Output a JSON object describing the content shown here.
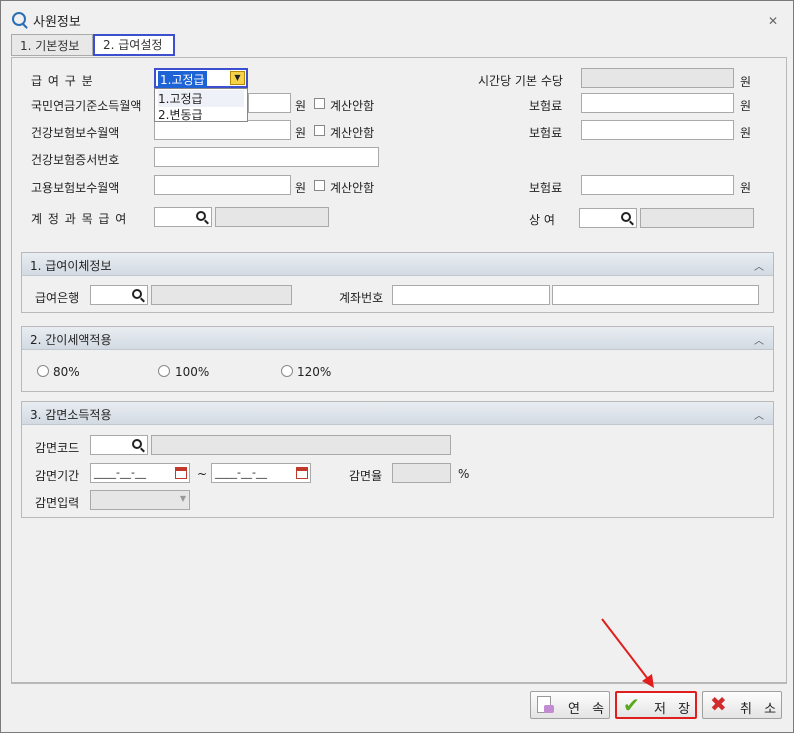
{
  "window": {
    "title": "사원정보",
    "close_glyph": "✕"
  },
  "tabs": [
    {
      "label": "1. 기본정보",
      "active": false
    },
    {
      "label": "2. 급여설정",
      "active": true
    }
  ],
  "form": {
    "pay_type_label": "급 여 구 분",
    "pay_type_value": "1.고정급",
    "pay_type_options": [
      "1.고정급",
      "2.변동급"
    ],
    "hourly_allowance_label": "시간당 기본 수당",
    "won": "원",
    "pension_label": "국민연금기준소득월액",
    "pension_premium_label": "보험료",
    "no_calc_label": "계산안함",
    "health_label": "건강보험보수월액",
    "health_premium_label": "보험료",
    "health_card_label": "건강보험증서번호",
    "employment_label": "고용보험보수월액",
    "employment_premium_label": "보험료",
    "account_subject_label": "계 정 과 목  급 여",
    "bonus_label": "상    여"
  },
  "section1": {
    "title": "1. 급여이체정보",
    "bank_label": "급여은행",
    "account_no_label": "계좌번호"
  },
  "section2": {
    "title": "2. 간이세액적용",
    "options": [
      "80%",
      "100%",
      "120%"
    ]
  },
  "section3": {
    "title": "3. 감면소득적용",
    "code_label": "감면코드",
    "period_label": "감면기간",
    "date_from": "____-__-__",
    "date_to": "____-__-__",
    "tilde": "~",
    "rate_label": "감면율",
    "percent": "%",
    "input_label": "감면입력"
  },
  "buttons": {
    "continue": "연 속",
    "save": "저 장",
    "cancel": "취 소"
  },
  "colors": {
    "highlight_border": "#3b4fcf",
    "annotation_red": "#e01e1e",
    "section_header": "#d9dfe6",
    "selected_option": "#1e63d6"
  },
  "icons": [
    "app-icon",
    "close-icon",
    "search-icon",
    "calendar-icon",
    "chevron-up-icon",
    "dropdown-arrow-icon",
    "copy-icon",
    "check-icon",
    "x-icon"
  ]
}
